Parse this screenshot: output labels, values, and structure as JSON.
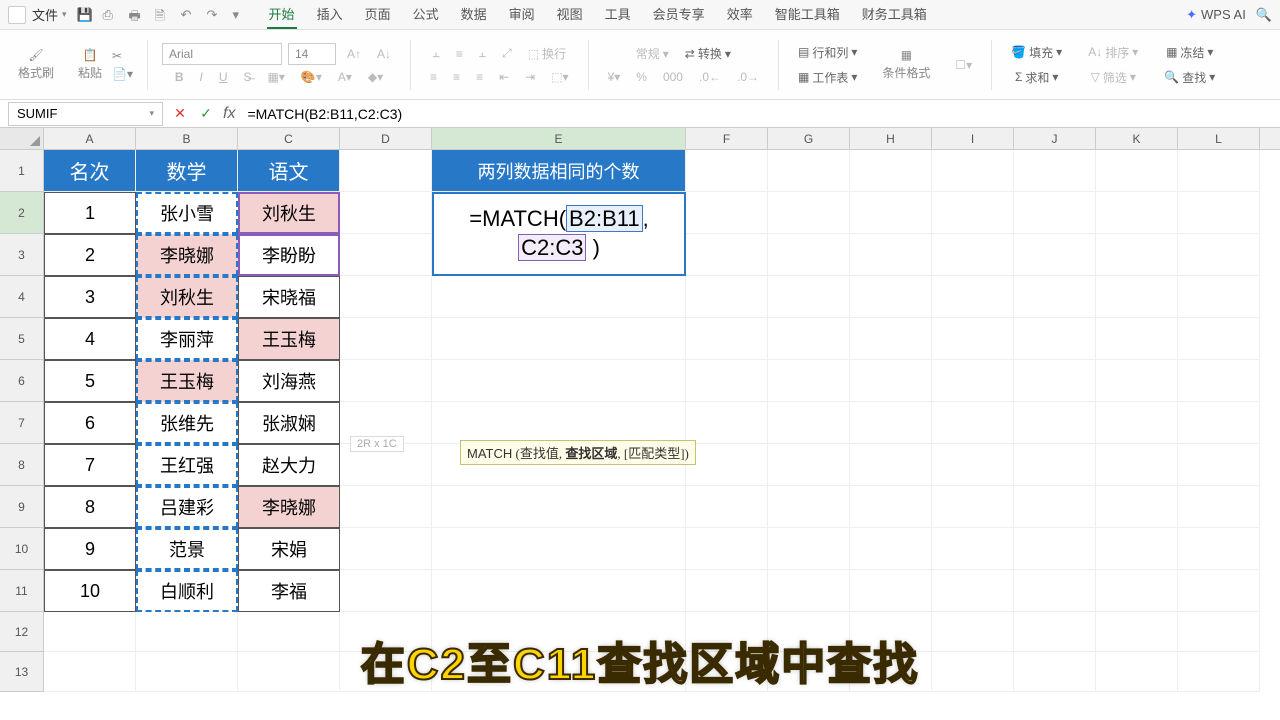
{
  "menu": {
    "file": "文件",
    "tabs": [
      "开始",
      "插入",
      "页面",
      "公式",
      "数据",
      "审阅",
      "视图",
      "工具",
      "会员专享",
      "效率",
      "智能工具箱",
      "财务工具箱"
    ],
    "active_tab": 0,
    "wps_ai": "WPS AI"
  },
  "toolbar": {
    "format_painter": "格式刷",
    "paste": "粘贴",
    "font_name": "Arial",
    "font_size": "14",
    "number_format": "常规",
    "wrap": "换行",
    "convert": "转换",
    "row_col": "行和列",
    "worksheet": "工作表",
    "cond_format": "条件格式",
    "fill": "填充",
    "sort": "排序",
    "freeze": "冻结",
    "sum": "求和",
    "filter": "筛选",
    "find": "查找"
  },
  "formula_bar": {
    "name_box": "SUMIF",
    "formula": "=MATCH(B2:B11,C2:C3)"
  },
  "columns": [
    "A",
    "B",
    "C",
    "D",
    "E",
    "F",
    "G",
    "H",
    "I",
    "J",
    "K",
    "L"
  ],
  "row_labels": [
    "1",
    "2",
    "3",
    "4",
    "5",
    "6",
    "7",
    "8",
    "9",
    "10",
    "11",
    "12",
    "13"
  ],
  "table": {
    "headers": {
      "A": "名次",
      "B": "数学",
      "C": "语文"
    },
    "rows": [
      {
        "A": "1",
        "B": "张小雪",
        "C": "刘秋生",
        "hlB": false,
        "hlC": true
      },
      {
        "A": "2",
        "B": "李晓娜",
        "C": "李盼盼",
        "hlB": true,
        "hlC": false
      },
      {
        "A": "3",
        "B": "刘秋生",
        "C": "宋晓福",
        "hlB": true,
        "hlC": false
      },
      {
        "A": "4",
        "B": "李丽萍",
        "C": "王玉梅",
        "hlB": false,
        "hlC": true
      },
      {
        "A": "5",
        "B": "王玉梅",
        "C": "刘海燕",
        "hlB": true,
        "hlC": false
      },
      {
        "A": "6",
        "B": "张维先",
        "C": "张淑娴",
        "hlB": false,
        "hlC": false
      },
      {
        "A": "7",
        "B": "王红强",
        "C": "赵大力",
        "hlB": false,
        "hlC": false
      },
      {
        "A": "8",
        "B": "吕建彩",
        "C": "李晓娜",
        "hlB": false,
        "hlC": true
      },
      {
        "A": "9",
        "B": "范景",
        "C": "宋娟",
        "hlB": false,
        "hlC": false
      },
      {
        "A": "10",
        "B": "白顺利",
        "C": "李福",
        "hlB": false,
        "hlC": false
      }
    ]
  },
  "panel": {
    "title": "两列数据相同的个数",
    "formula_prefix": "=MATCH(",
    "ref1": "B2:B11",
    "sep": ",",
    "ref2": "C2:C3",
    "suffix": ")"
  },
  "tooltip": {
    "fn": "MATCH",
    "args": "(查找值, 查找区域, [匹配类型])",
    "bold_arg": "查找区域"
  },
  "size_hint": "2R x 1C",
  "caption": "在C2至C11查找区域中查找",
  "chart_data": {
    "type": "table",
    "columns": [
      "名次",
      "数学",
      "语文"
    ],
    "rows": [
      [
        1,
        "张小雪",
        "刘秋生"
      ],
      [
        2,
        "李晓娜",
        "李盼盼"
      ],
      [
        3,
        "刘秋生",
        "宋晓福"
      ],
      [
        4,
        "李丽萍",
        "王玉梅"
      ],
      [
        5,
        "王玉梅",
        "刘海燕"
      ],
      [
        6,
        "张维先",
        "张淑娴"
      ],
      [
        7,
        "王红强",
        "赵大力"
      ],
      [
        8,
        "吕建彩",
        "李晓娜"
      ],
      [
        9,
        "范景",
        "宋娟"
      ],
      [
        10,
        "白顺利",
        "李福"
      ]
    ]
  }
}
